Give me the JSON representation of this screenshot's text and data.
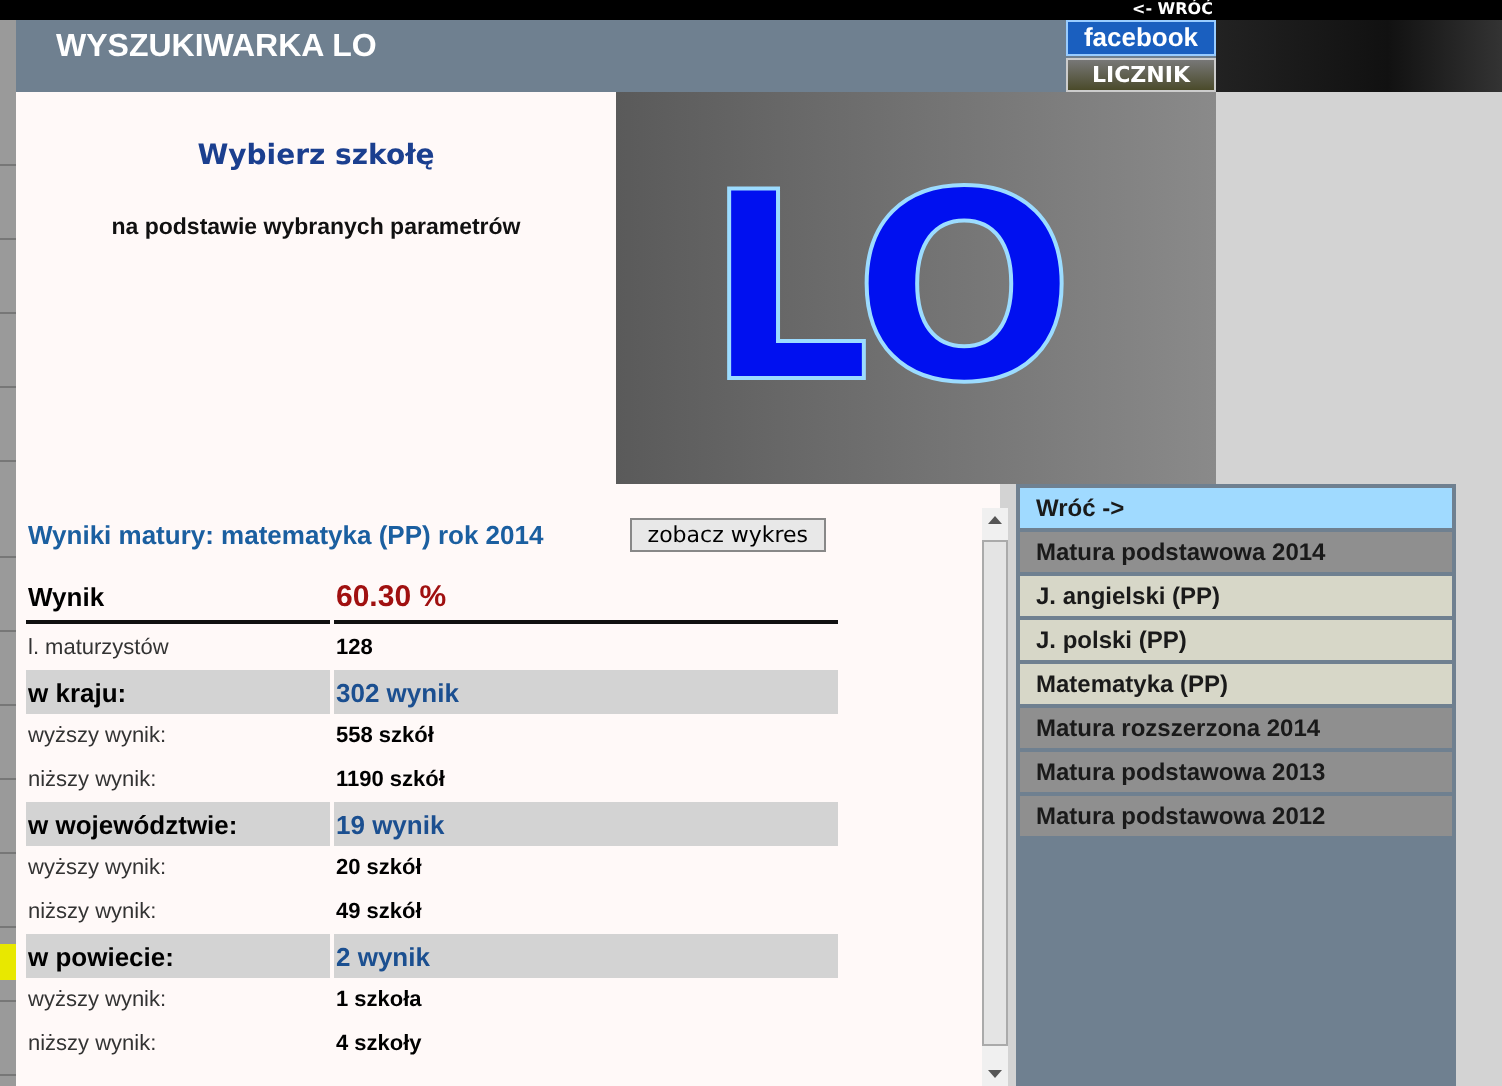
{
  "back_link": "<- WRÓĆ",
  "header": {
    "title": "WYSZUKIWARKA LO",
    "facebook_button": "facebook",
    "counter_button": "LICZNIK"
  },
  "intro": {
    "heading": "Wybierz szkołę",
    "subtitle": "na podstawie wybranych parametrów",
    "logo": "LO"
  },
  "results": {
    "title": "Wyniki matury: matematyka (PP) rok 2014",
    "chart_button": "zobacz wykres",
    "rows": [
      {
        "kind": "main",
        "label": "Wynik",
        "value": "60.30 %"
      },
      {
        "kind": "detail",
        "label": "l. maturzystów",
        "value": "128"
      },
      {
        "kind": "region",
        "label": "w kraju:",
        "value": "302 wynik"
      },
      {
        "kind": "detail",
        "label": "wyższy wynik:",
        "value": "558 szkół"
      },
      {
        "kind": "detail",
        "label": "niższy wynik:",
        "value": "1190 szkół"
      },
      {
        "kind": "region",
        "label": "w województwie:",
        "value": "19 wynik"
      },
      {
        "kind": "detail",
        "label": "wyższy wynik:",
        "value": "20 szkół"
      },
      {
        "kind": "detail",
        "label": "niższy wynik:",
        "value": "49 szkół"
      },
      {
        "kind": "region",
        "label": "w powiecie:",
        "value": "2 wynik"
      },
      {
        "kind": "detail",
        "label": "wyższy wynik:",
        "value": "1 szkoła"
      },
      {
        "kind": "detail",
        "label": "niższy wynik:",
        "value": "4 szkoły"
      }
    ]
  },
  "menu": [
    {
      "kind": "back",
      "label": "Wróć ->"
    },
    {
      "kind": "header",
      "label": "Matura podstawowa 2014"
    },
    {
      "kind": "item",
      "label": "J. angielski (PP)"
    },
    {
      "kind": "item",
      "label": "J. polski (PP)"
    },
    {
      "kind": "item",
      "label": "Matematyka (PP)"
    },
    {
      "kind": "header",
      "label": "Matura rozszerzona 2014"
    },
    {
      "kind": "header",
      "label": "Matura podstawowa 2013"
    },
    {
      "kind": "header",
      "label": "Matura podstawowa 2012"
    }
  ]
}
